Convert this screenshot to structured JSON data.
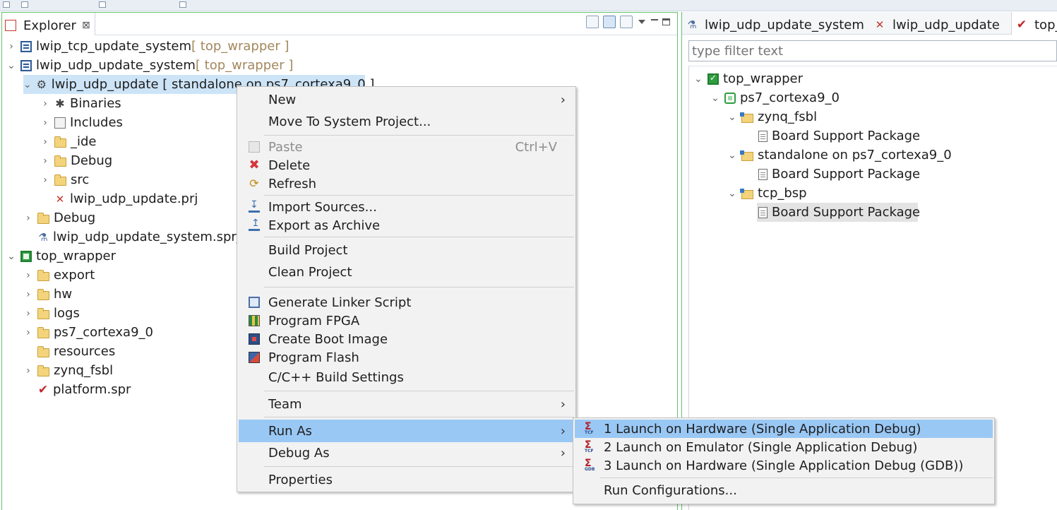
{
  "explorer": {
    "tab_label": "Explorer",
    "tab_close": "⊠",
    "tree": [
      {
        "label": "lwip_tcp_update_system",
        "deco": " [ top_wrapper ]",
        "icon": "system-project-icon"
      },
      {
        "label": "lwip_udp_update_system",
        "deco": " [ top_wrapper ]",
        "icon": "system-project-icon"
      },
      {
        "label": "lwip_udp_update [ standalone on ps7_cortexa9_0 ]",
        "icon": "application-project-icon"
      },
      {
        "label": "Binaries",
        "icon": "binaries-icon"
      },
      {
        "label": "Includes",
        "icon": "includes-icon"
      },
      {
        "label": "_ide",
        "icon": "folder-icon"
      },
      {
        "label": "Debug",
        "icon": "folder-icon"
      },
      {
        "label": "src",
        "icon": "folder-icon"
      },
      {
        "label": "lwip_udp_update.prj",
        "icon": "prj-file-icon"
      },
      {
        "label": "Debug",
        "icon": "folder-icon"
      },
      {
        "label": "lwip_udp_update_system.sprj",
        "icon": "sprj-file-icon"
      },
      {
        "label": "top_wrapper",
        "icon": "platform-project-icon"
      },
      {
        "label": "export",
        "icon": "folder-icon"
      },
      {
        "label": "hw",
        "icon": "folder-icon"
      },
      {
        "label": "logs",
        "icon": "folder-icon"
      },
      {
        "label": "ps7_cortexa9_0",
        "icon": "folder-icon"
      },
      {
        "label": "resources",
        "icon": "folder-icon"
      },
      {
        "label": "zynq_fsbl",
        "icon": "folder-icon"
      },
      {
        "label": "platform.spr",
        "icon": "spr-file-icon"
      }
    ]
  },
  "right_panel": {
    "tabs": [
      "lwip_udp_update_system",
      "lwip_udp_update",
      "top_w"
    ],
    "filter_placeholder": "type filter text",
    "tree": [
      {
        "label": "top_wrapper"
      },
      {
        "label": "ps7_cortexa9_0"
      },
      {
        "label": "zynq_fsbl"
      },
      {
        "label": "Board Support Package"
      },
      {
        "label": "standalone on ps7_cortexa9_0"
      },
      {
        "label": "Board Support Package"
      },
      {
        "label": "tcp_bsp"
      },
      {
        "label": "Board Support Package"
      }
    ]
  },
  "context_menu": {
    "items": [
      {
        "label": "New",
        "arrow": "›"
      },
      {
        "label": "Move To System Project..."
      },
      {
        "label": "Paste",
        "shortcut": "Ctrl+V",
        "disabled": true
      },
      {
        "label": "Delete"
      },
      {
        "label": "Refresh"
      },
      {
        "label": "Import Sources..."
      },
      {
        "label": "Export as Archive"
      },
      {
        "label": "Build Project"
      },
      {
        "label": "Clean Project"
      },
      {
        "label": "Generate Linker Script"
      },
      {
        "label": "Program FPGA"
      },
      {
        "label": "Create Boot Image"
      },
      {
        "label": "Program Flash"
      },
      {
        "label": "C/C++ Build Settings"
      },
      {
        "label": "Team",
        "arrow": "›"
      },
      {
        "label": "Run As",
        "arrow": "›"
      },
      {
        "label": "Debug As",
        "arrow": "›"
      },
      {
        "label": "Properties"
      }
    ]
  },
  "run_as_submenu": {
    "items": [
      {
        "label": "1 Launch on Hardware (Single Application Debug)",
        "icon_tag": "TCF"
      },
      {
        "label": "2 Launch on Emulator (Single Application Debug)",
        "icon_tag": "TCF"
      },
      {
        "label": "3 Launch on Hardware (Single Application Debug (GDB))",
        "icon_tag": "GDB"
      },
      {
        "label": "Run Configurations..."
      }
    ]
  },
  "colors": {
    "selection": "#cde4f7",
    "menu_hover": "#9ac8f5",
    "active_border": "#63c26e",
    "decoration_text": "#a3875c"
  }
}
